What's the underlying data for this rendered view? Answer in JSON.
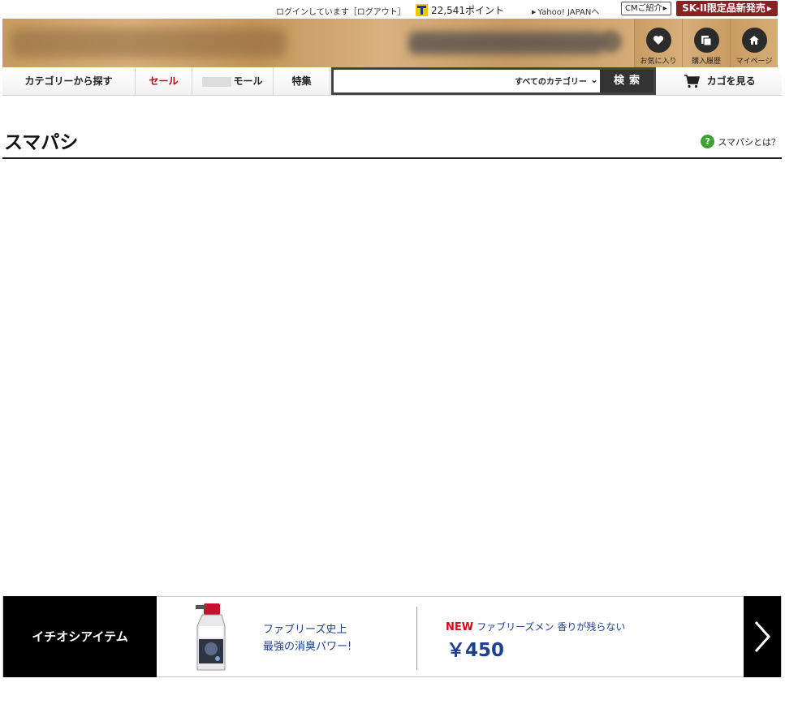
{
  "topbar": {
    "login_text": "ログインしています［ログアウト］",
    "points": "22,541ポイント",
    "yahoo_link": "Yahoo! JAPANへ",
    "cm_button": "CMご紹介",
    "promo_button": "SK-II限定品新発売"
  },
  "quick_links": [
    {
      "label": "お気に入り",
      "icon": "heart-icon"
    },
    {
      "label": "購入履歴",
      "icon": "history-icon"
    },
    {
      "label": "マイページ",
      "icon": "home-icon"
    }
  ],
  "nav": {
    "category": "カテゴリーから探す",
    "sale": "セール",
    "mall": "モール",
    "feature": "特集",
    "search_placeholder": "",
    "search_category": "すべてのカテゴリー",
    "search_button": "検索",
    "cart": "カゴを見る"
  },
  "page": {
    "title": "スマパシ",
    "help_link": "スマパシとは？"
  },
  "recommend": {
    "label": "イチオシアイテム",
    "copy_line1": "ファブリーズ史上",
    "copy_line2": "最強の消臭パワー!",
    "badge": "NEW",
    "product_name": "ファブリーズメン 香りが残らない",
    "price": "￥450"
  },
  "colors": {
    "sale_red": "#c40010",
    "promo_bg": "#8a2024",
    "help_green": "#3ea233",
    "text_navy": "#1f3f91"
  }
}
